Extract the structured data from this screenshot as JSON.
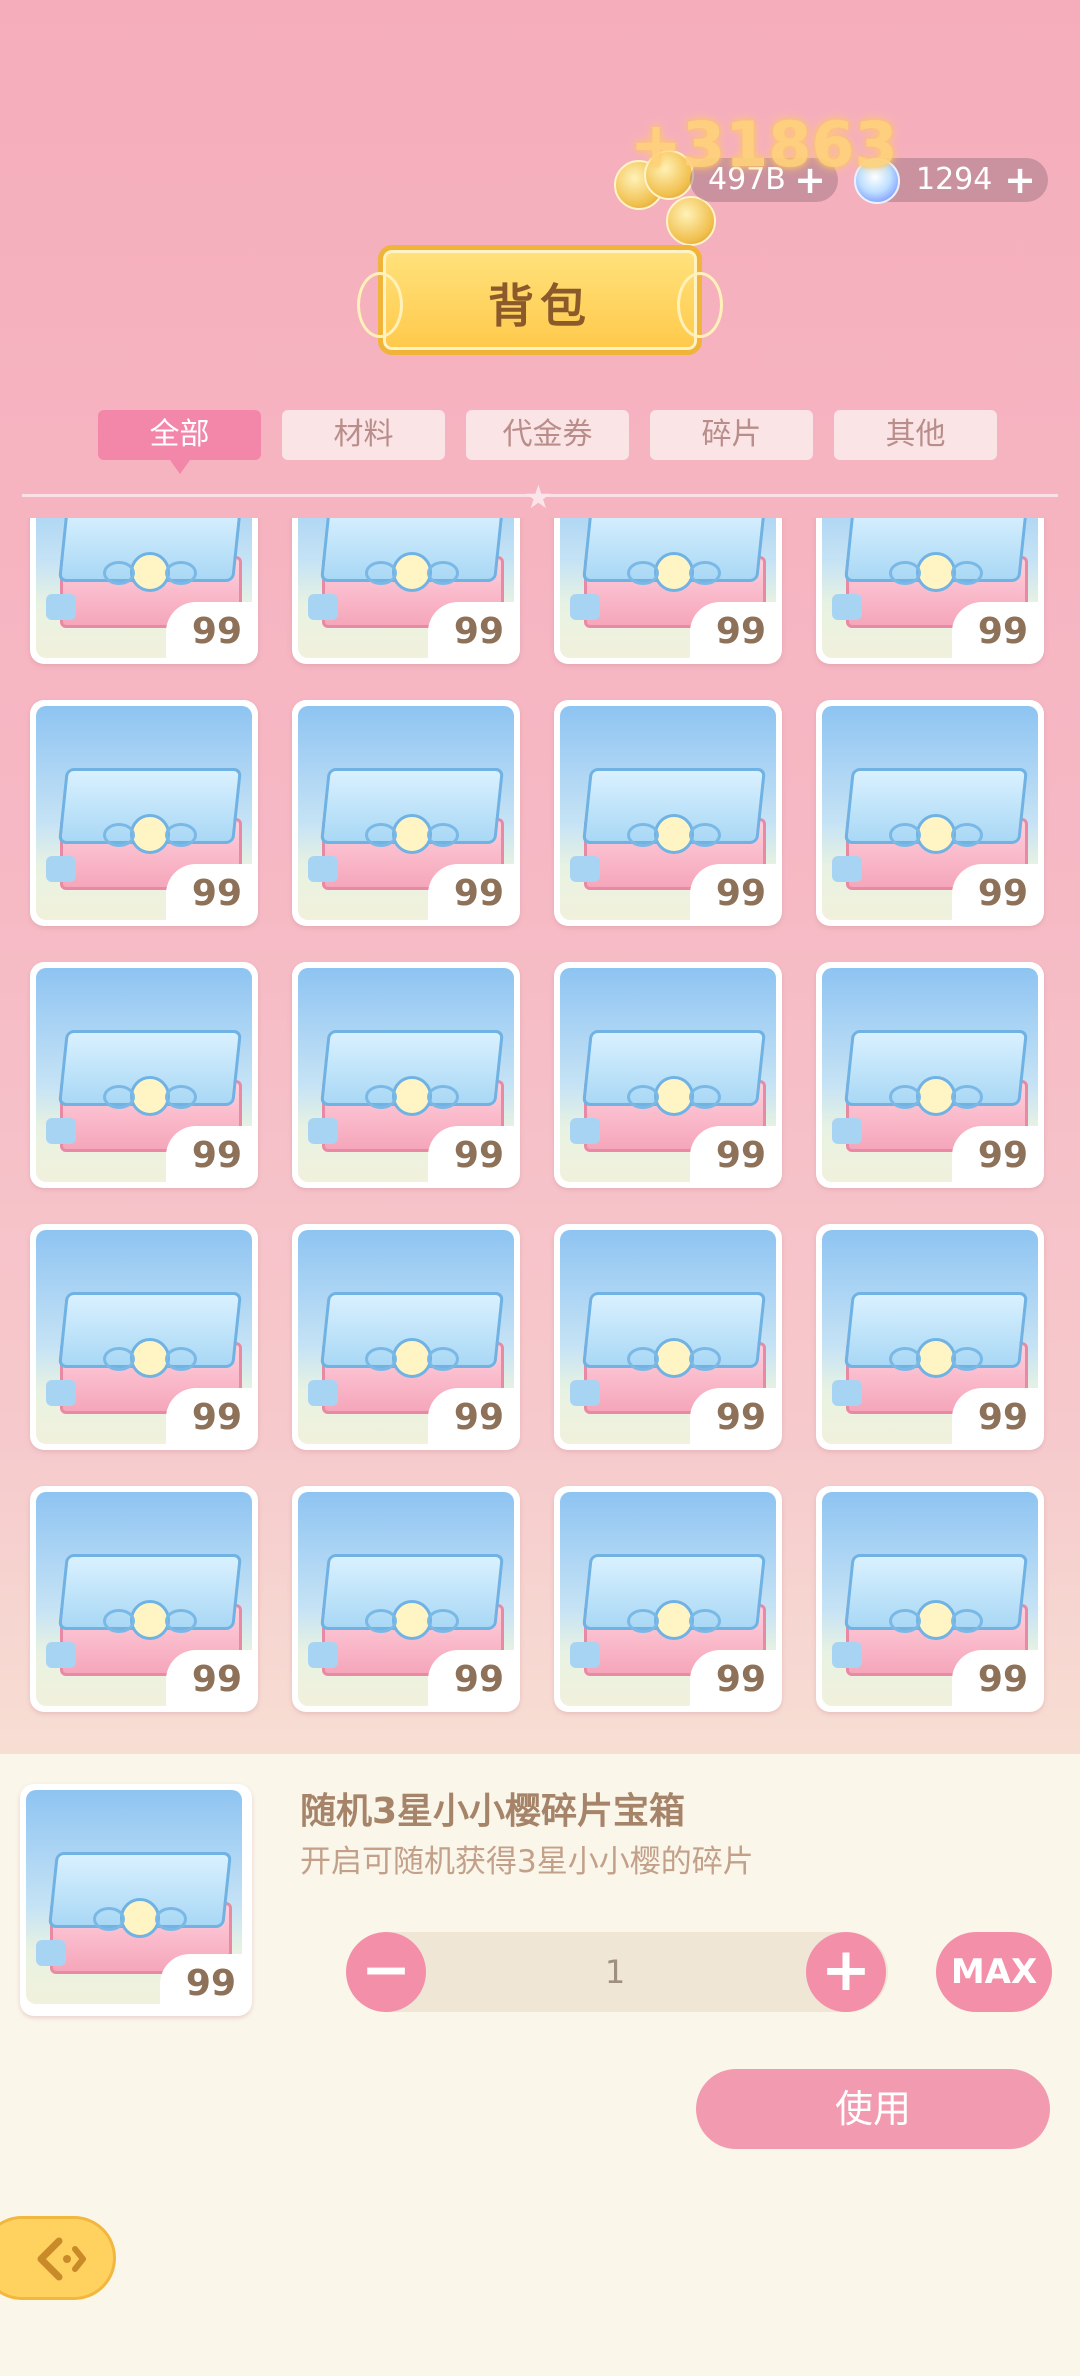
{
  "currency": {
    "floating_gain": "+31863",
    "coins": "497B",
    "gems": "1294",
    "coin_icon": "gold-coin-icon",
    "gem_icon": "crystal-gem-icon"
  },
  "header": {
    "title": "背包"
  },
  "tabs": [
    {
      "label": "全部",
      "active": true
    },
    {
      "label": "材料",
      "active": false
    },
    {
      "label": "代金券",
      "active": false
    },
    {
      "label": "碎片",
      "active": false
    },
    {
      "label": "其他",
      "active": false
    }
  ],
  "items": [
    {
      "qty": "99"
    },
    {
      "qty": "99"
    },
    {
      "qty": "99"
    },
    {
      "qty": "99"
    },
    {
      "qty": "99"
    },
    {
      "qty": "99"
    },
    {
      "qty": "99"
    },
    {
      "qty": "99"
    },
    {
      "qty": "99"
    },
    {
      "qty": "99"
    },
    {
      "qty": "99"
    },
    {
      "qty": "99"
    },
    {
      "qty": "99"
    },
    {
      "qty": "99"
    },
    {
      "qty": "99"
    },
    {
      "qty": "99"
    },
    {
      "qty": "99"
    },
    {
      "qty": "99"
    },
    {
      "qty": "99"
    },
    {
      "qty": "99"
    }
  ],
  "detail": {
    "name": "随机3星小小樱碎片宝箱",
    "description": "开启可随机获得3星小小樱的碎片",
    "qty_owned": "99",
    "quantity": "1",
    "minus_label": "−",
    "plus_label": "+",
    "max_label": "MAX",
    "use_label": "使用"
  },
  "colors": {
    "accent_pink": "#f38fa8",
    "tab_active": "#f287a9",
    "gold": "#ffc94a"
  }
}
